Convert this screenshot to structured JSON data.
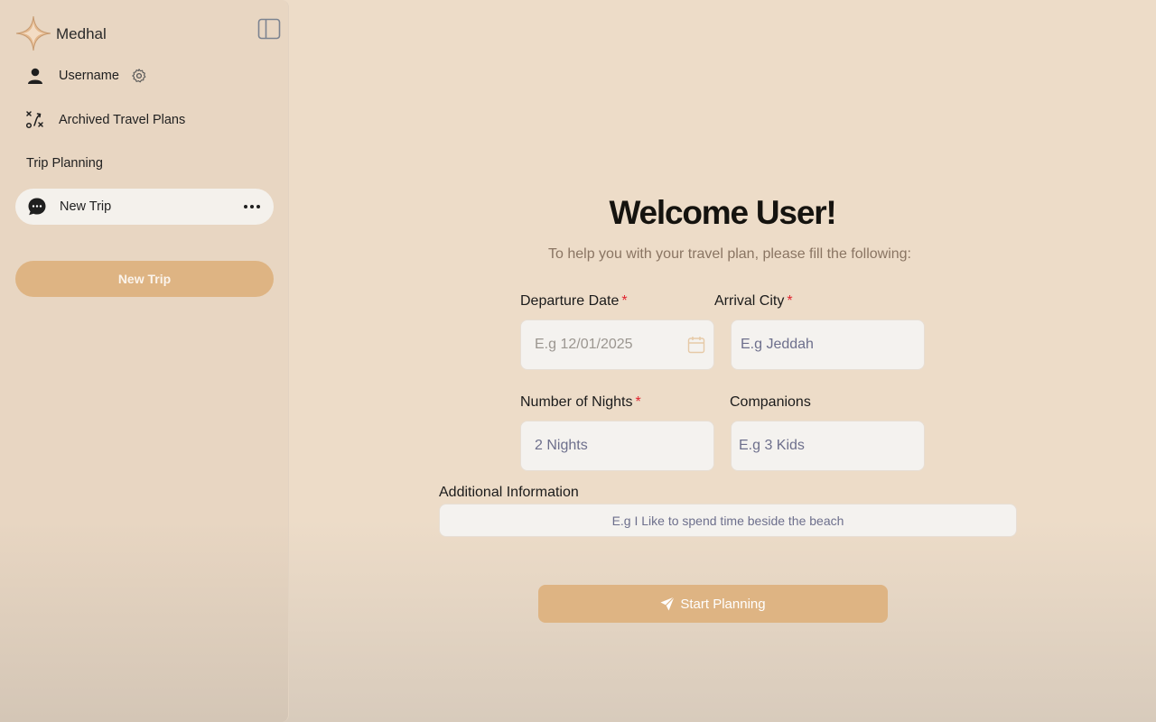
{
  "brand": {
    "name": "Medhal"
  },
  "sidebar": {
    "username": "Username",
    "archived_label": "Archived Travel Plans",
    "section_label": "Trip Planning",
    "chats": [
      {
        "label": "New Trip"
      }
    ],
    "new_trip_button": "New Trip"
  },
  "main": {
    "welcome": "Welcome User!",
    "subtitle": "To help you with your travel plan, please fill the following:",
    "fields": {
      "departure_date": {
        "label": "Departure Date",
        "required_mark": "*",
        "placeholder": "E.g 12/01/2025"
      },
      "arrival_city": {
        "label": "Arrival City",
        "required_mark": "*",
        "placeholder": "E.g Jeddah"
      },
      "nights": {
        "label": "Number of Nights",
        "required_mark": "*",
        "placeholder": "2 Nights"
      },
      "companions": {
        "label": "Companions",
        "placeholder": "E.g 3 Kids"
      },
      "additional_info": {
        "label": "Additional Information",
        "placeholder": "E.g I Like to spend time beside the beach"
      }
    },
    "start_button": "Start Planning"
  },
  "colors": {
    "accent": "#deb483",
    "background": "#eddcc8",
    "required": "#e0242f"
  }
}
